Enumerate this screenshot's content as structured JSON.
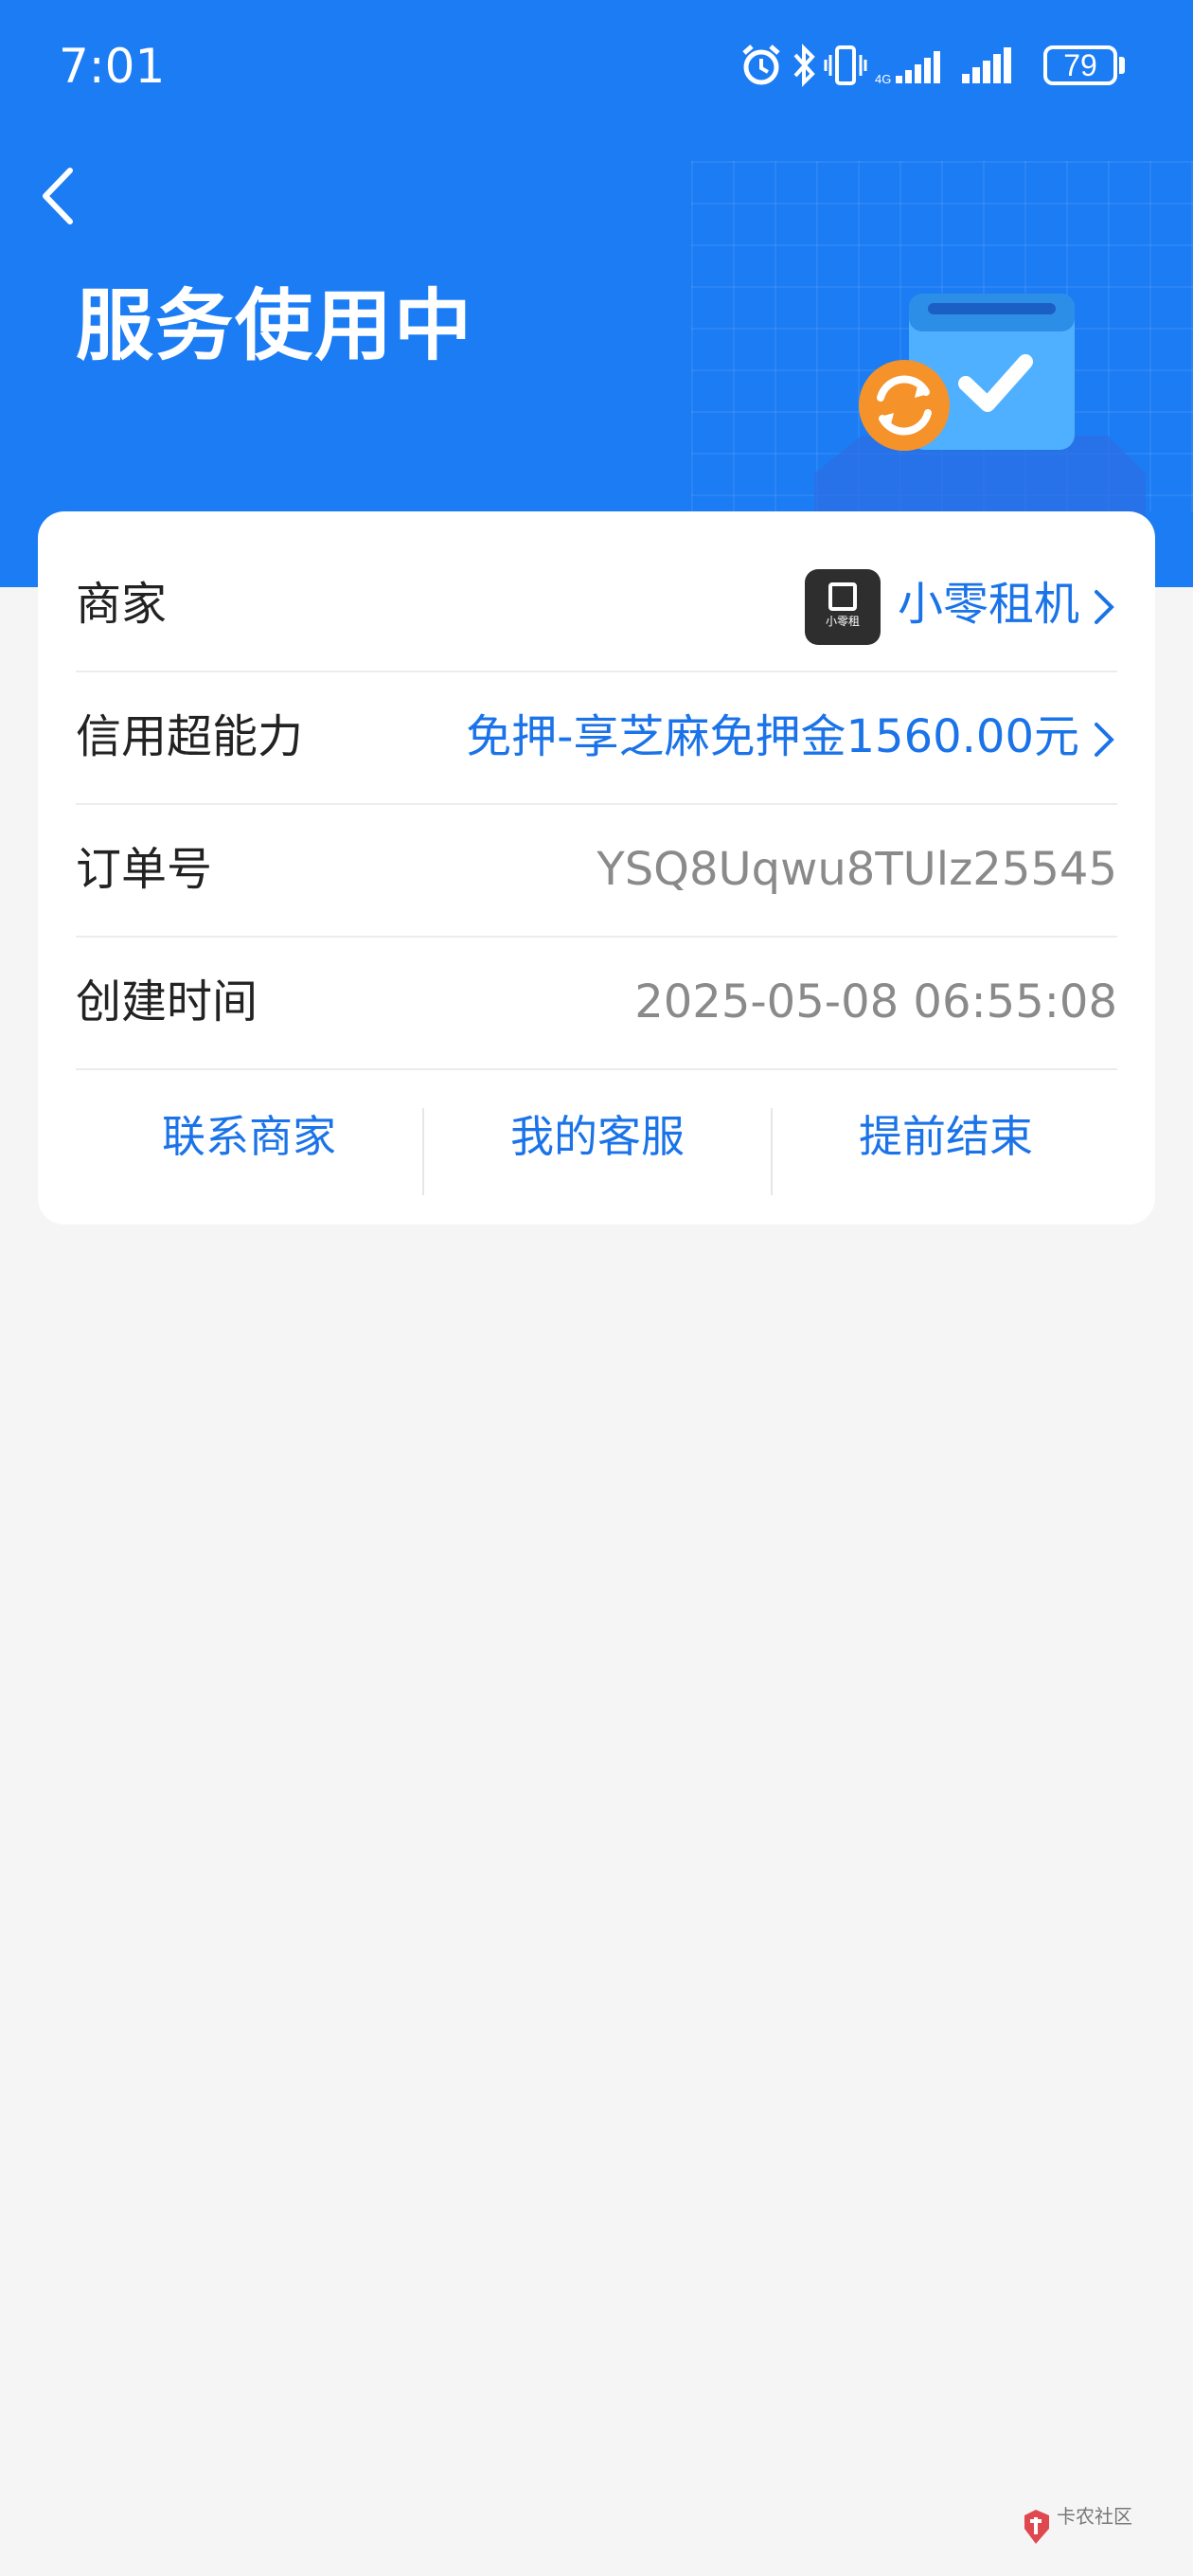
{
  "status_bar": {
    "time": "7:01",
    "battery": "79",
    "icons": [
      "alarm-icon",
      "bluetooth-icon",
      "vibrate-icon",
      "signal-icon",
      "signal-icon",
      "battery-icon"
    ]
  },
  "header": {
    "title": "服务使用中",
    "back_icon": "chevron-left-icon",
    "background_color": "#1b7cf4"
  },
  "order": {
    "rows": [
      {
        "label": "商家",
        "value": "小零租机",
        "merchant_logo_text": "小零租"
      },
      {
        "label": "信用超能力",
        "value": "免押-享芝麻免押金1560.00元"
      },
      {
        "label": "订单号",
        "value": "YSQ8Uqwu8TUlz25545"
      },
      {
        "label": "创建时间",
        "value": "2025-05-08 06:55:08"
      }
    ],
    "actions": [
      "联系商家",
      "我的客服",
      "提前结束"
    ]
  },
  "colors": {
    "accent": "#1a73e8",
    "orange": "#f5932a",
    "muted_text": "#8a8a8a",
    "page_bg": "#f5f5f5"
  },
  "watermark": {
    "text": "卡农社区"
  }
}
